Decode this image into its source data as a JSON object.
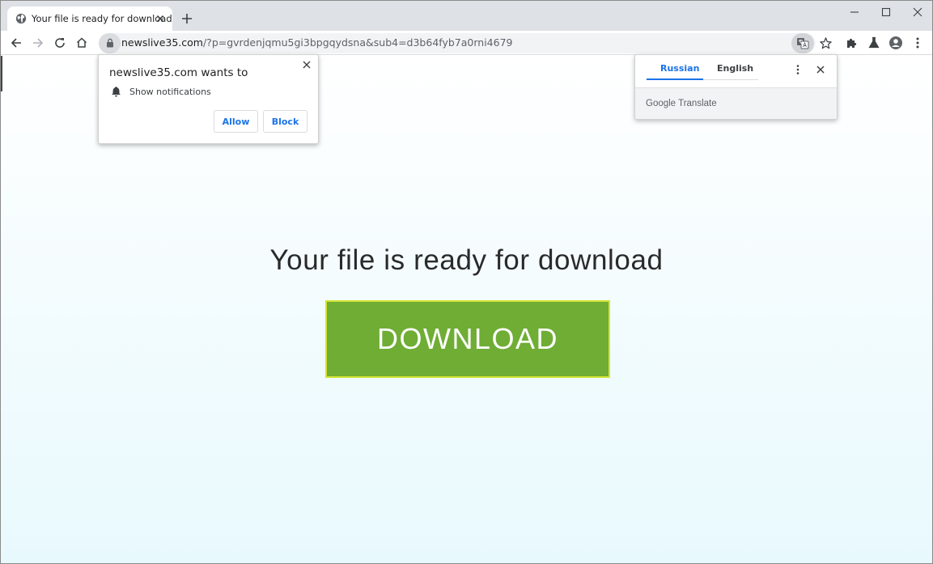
{
  "browser": {
    "tab": {
      "title": "Your file is ready for download"
    },
    "url": {
      "host": "newslive35.com",
      "path": "/?p=gvrdenjqmu5gi3bpgqydsna&sub4=d3b64fyb7a0rni4679"
    },
    "icons": {
      "favicon": "globe-icon",
      "tab_close": "close-icon",
      "new_tab": "plus-icon",
      "minimize": "minimize-icon",
      "maximize": "maximize-icon",
      "close_window": "close-icon",
      "back": "arrow-left-icon",
      "forward": "arrow-right-icon",
      "reload": "reload-icon",
      "home": "home-icon",
      "lock": "lock-icon",
      "translate": "translate-icon",
      "bookmark": "star-icon",
      "extensions": "puzzle-icon",
      "labs": "flask-icon",
      "profile": "person-icon",
      "menu": "kebab-icon"
    }
  },
  "notification_prompt": {
    "title": "newslive35.com wants to",
    "permission": "Show notifications",
    "allow_label": "Allow",
    "block_label": "Block"
  },
  "translate_bubble": {
    "source_lang": "Russian",
    "target_lang": "English",
    "brand_google": "Google",
    "brand_product": "Translate"
  },
  "page": {
    "heading": "Your file is ready for download",
    "download_label": "DOWNLOAD"
  },
  "colors": {
    "download_button": "#6fad35",
    "download_border": "#d4e535",
    "accent_blue": "#1a73e8",
    "page_gradient_bottom": "#e8f9fd"
  }
}
